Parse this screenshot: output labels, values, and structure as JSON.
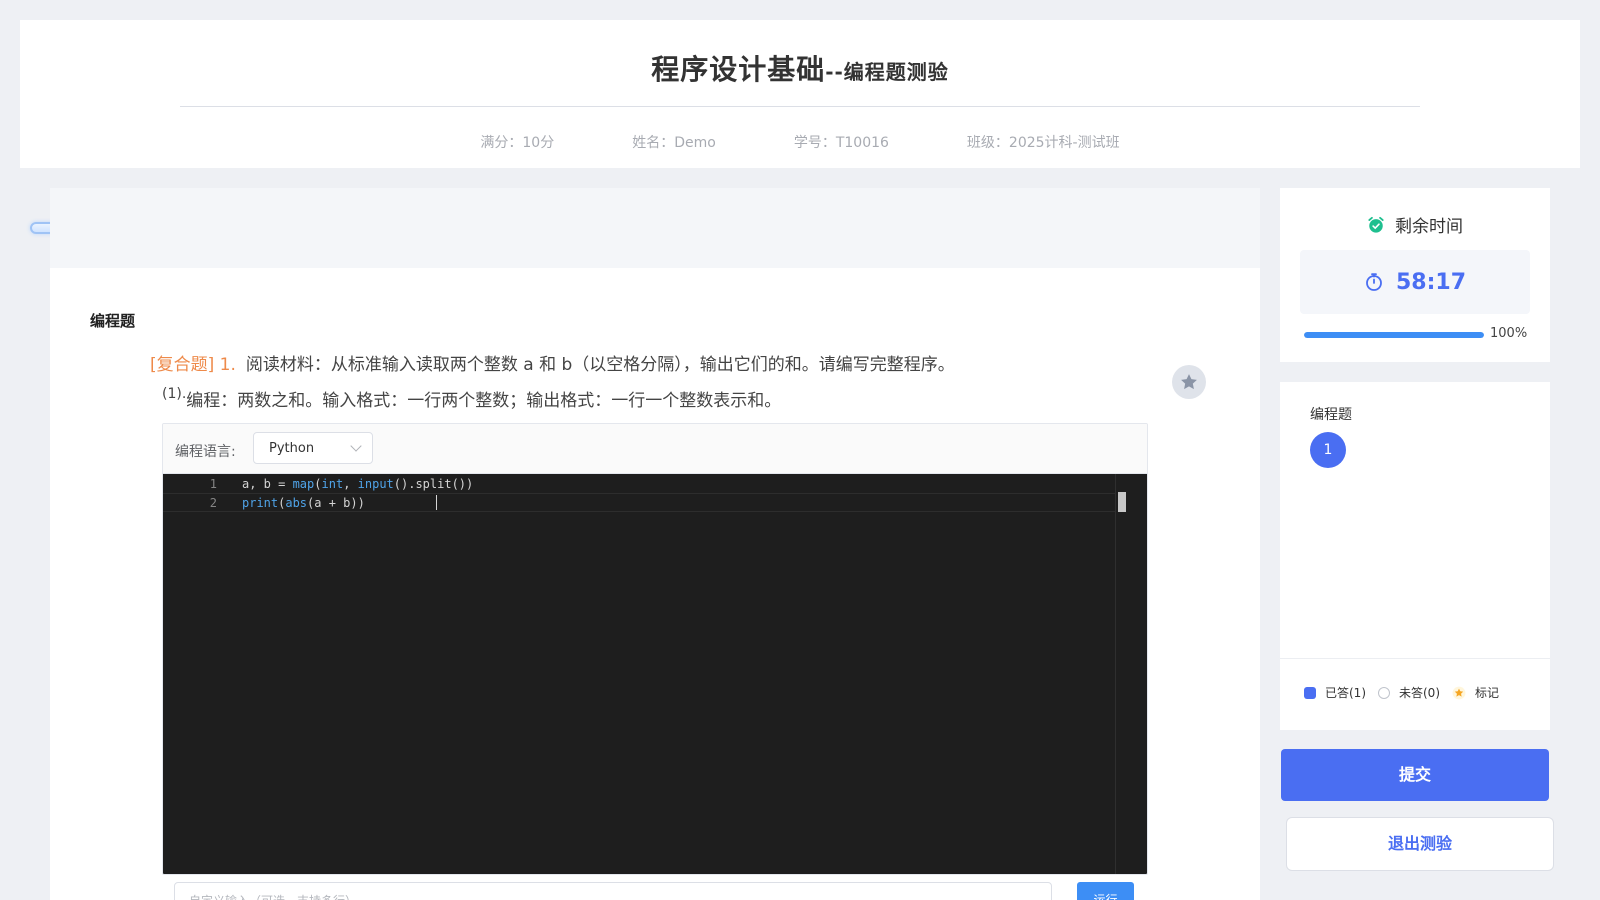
{
  "header": {
    "title_main": "程序设计基础",
    "title_sub": "--编程题测验",
    "meta": {
      "score": "满分：10分",
      "name": "姓名：Demo",
      "student_id": "学号：T10016",
      "class": "班级：2025计科-测试班"
    }
  },
  "main": {
    "section_title": "编程题",
    "question": {
      "tag": "[复合题] 1.",
      "text": "阅读材料：从标准输入读取两个整数 a 和 b（以空格分隔），输出它们的和。请编写完整程序。"
    },
    "sub_question": {
      "number": "(1).",
      "text": "编程：两数之和。输入格式：一行两个整数；输出格式：一行一个整数表示和。"
    },
    "editor": {
      "language_label": "编程语言:",
      "language_selected": "Python",
      "lines": [
        {
          "no": "1",
          "text": "a, b = map(int, input().split())"
        },
        {
          "no": "2",
          "text": "print(abs(a + b))"
        }
      ]
    },
    "custom_input_placeholder": "自定义输入（可选，支持多行）",
    "run_label": "运行"
  },
  "timer": {
    "label": "剩余时间",
    "value": "58:17",
    "progress_percent": 100,
    "progress_text": "100%"
  },
  "nav": {
    "title": "编程题",
    "items": [
      "1"
    ],
    "legend": {
      "answered": "已答(1)",
      "unanswered": "未答(0)",
      "marked": "标记"
    }
  },
  "actions": {
    "submit": "提交",
    "exit": "退出测验"
  },
  "colors": {
    "accent": "#4a6ef2",
    "tag": "#ee8a4a",
    "run": "#3d8ef5",
    "editor_bg": "#1e1e1e"
  }
}
